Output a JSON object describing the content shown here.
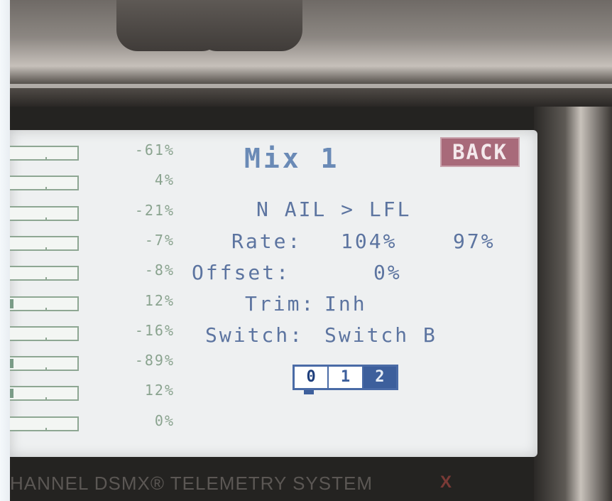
{
  "screen": {
    "back_label": "BACK",
    "title": "Mix 1",
    "mix_path": "N AIL > LFL",
    "rate": {
      "label": "Rate:",
      "value_1": "104%",
      "value_2": "97%"
    },
    "offset": {
      "label": "Offset:",
      "value": "0%"
    },
    "trim": {
      "label": "Trim:",
      "value": "Inh"
    },
    "switch": {
      "label": "Switch:",
      "value": "Switch B"
    },
    "pages": [
      "0",
      "1",
      "2"
    ],
    "selected_page": "2"
  },
  "channel_monitor": [
    {
      "percent": "-61%",
      "level": -61
    },
    {
      "percent": "4%",
      "level": 4
    },
    {
      "percent": "-21%",
      "level": -21
    },
    {
      "percent": "-7%",
      "level": -7
    },
    {
      "percent": "-8%",
      "level": -8
    },
    {
      "percent": "12%",
      "level": 12
    },
    {
      "percent": "-16%",
      "level": -16
    },
    {
      "percent": "-89%",
      "level": -89
    },
    {
      "percent": "12%",
      "level": 12
    },
    {
      "percent": "0%",
      "level": 0
    }
  ],
  "device_footer": {
    "text": "HANNEL DSMX® TELEMETRY SYSTEM"
  },
  "colors": {
    "lcd_text": "#5c74a0",
    "back_button": "#a86a7a",
    "monitor_green": "#8ea793",
    "page_selected": "#3d5f9c"
  }
}
